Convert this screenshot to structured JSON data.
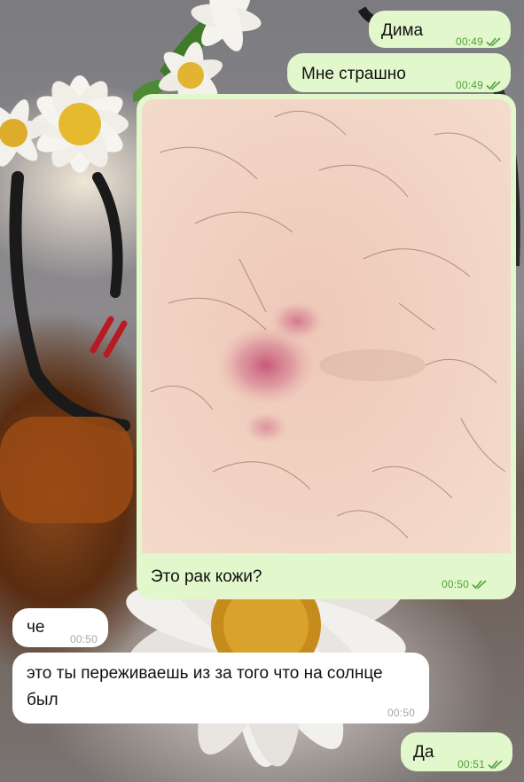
{
  "chat": {
    "messages": [
      {
        "text": "Дима",
        "time": "00:49",
        "direction": "outgoing",
        "read": true
      },
      {
        "text": "Мне страшно",
        "time": "00:49",
        "direction": "outgoing",
        "read": true
      },
      {
        "text": "Это рак кожи?",
        "time": "00:50",
        "direction": "outgoing",
        "read": true,
        "attachment": "skin-photo"
      },
      {
        "text": "че",
        "time": "00:50",
        "direction": "incoming"
      },
      {
        "text": "это ты переживаешь из за того что на солнце был",
        "time": "00:50",
        "direction": "incoming"
      },
      {
        "text": "Да",
        "time": "00:51",
        "direction": "outgoing",
        "read": true
      }
    ]
  },
  "colors": {
    "outgoing_bubble": "#e2f7cb",
    "incoming_bubble": "#ffffff",
    "outgoing_time": "#52a13c",
    "incoming_time": "#a7a7a7"
  },
  "icons": {
    "read_receipt": "double-check-icon"
  }
}
